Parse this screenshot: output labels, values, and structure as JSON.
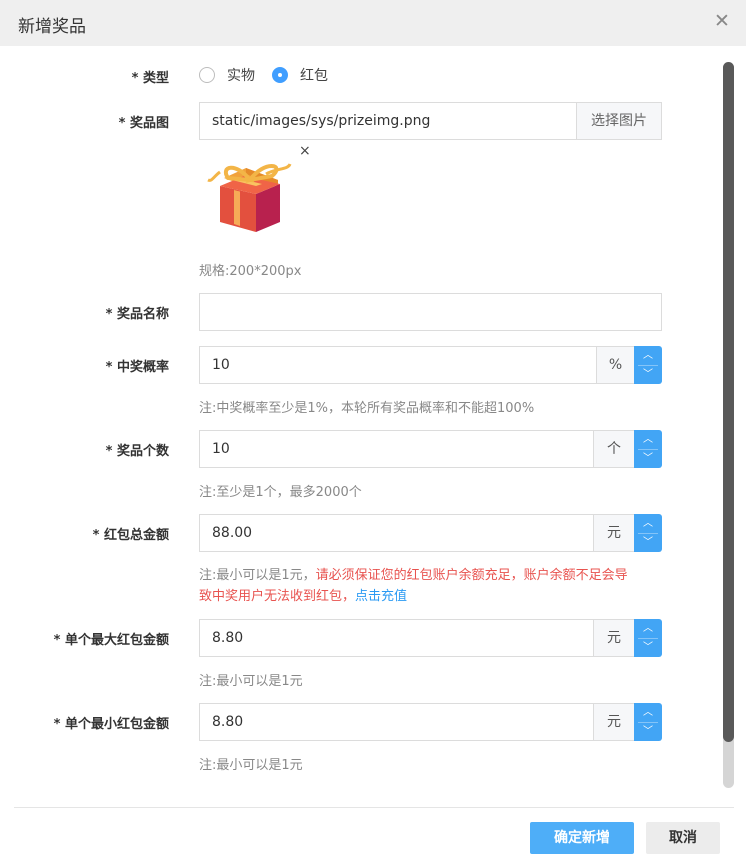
{
  "dialog": {
    "title": "新增奖品",
    "close_icon": "close-icon"
  },
  "form": {
    "type": {
      "label": "* 类型",
      "options": [
        "实物",
        "红包"
      ],
      "selected": "红包"
    },
    "prize_image": {
      "label": "* 奖品图",
      "value": "static/images/sys/prizeimg.png",
      "button": "选择图片",
      "remove": "×",
      "preview_icon": "gift-box-icon",
      "spec": "规格:200*200px"
    },
    "prize_name": {
      "label": "* 奖品名称",
      "value": ""
    },
    "win_rate": {
      "label": "* 中奖概率",
      "value": "10",
      "unit": "%",
      "hint": "注:中奖概率至少是1%，本轮所有奖品概率和不能超100%"
    },
    "prize_count": {
      "label": "* 奖品个数",
      "value": "10",
      "unit": "个",
      "hint": "注:至少是1个，最多2000个"
    },
    "total_amount": {
      "label": "* 红包总金额",
      "value": "88.00",
      "unit": "元",
      "hint_prefix": "注:最小可以是1元，",
      "hint_warning_line1": "请必须保证您的红包账户余额充足，账户余额不足会导",
      "hint_warning_line2": "致中奖用户无法收到红包，",
      "hint_link": "点击充值"
    },
    "max_single": {
      "label": "* 单个最大红包金额",
      "value": "8.80",
      "unit": "元",
      "hint": "注:最小可以是1元"
    },
    "min_single": {
      "label": "* 单个最小红包金额",
      "value": "8.80",
      "unit": "元",
      "hint": "注:最小可以是1元"
    }
  },
  "footer": {
    "confirm": "确定新增",
    "cancel": "取消"
  },
  "colors": {
    "accent": "#409eff",
    "primary_button": "#4eaef8",
    "warning": "#e8534f",
    "link": "#2b9af3"
  }
}
